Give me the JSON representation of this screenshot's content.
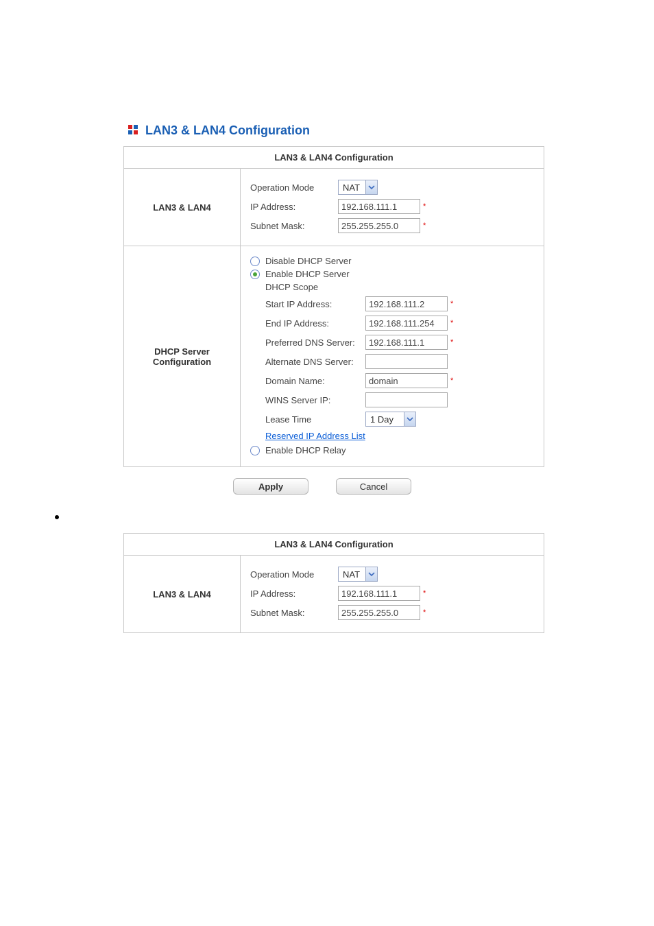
{
  "header": {
    "title": "LAN3 & LAN4 Configuration"
  },
  "section1": {
    "tableTitle": "LAN3 & LAN4 Configuration",
    "lan": {
      "rowLabel": "LAN3 & LAN4",
      "opModeLabel": "Operation Mode",
      "opModeValue": "NAT",
      "ipLabel": "IP Address:",
      "ipValue": "192.168.111.1",
      "maskLabel": "Subnet Mask:",
      "maskValue": "255.255.255.0"
    },
    "dhcp": {
      "rowLabel": "DHCP Server Configuration",
      "disableLabel": "Disable DHCP Server",
      "enableLabel": "Enable DHCP Server",
      "scopeLabel": "DHCP Scope",
      "startIpLabel": "Start IP Address:",
      "startIpValue": "192.168.111.2",
      "endIpLabel": "End IP Address:",
      "endIpValue": "192.168.111.254",
      "prefDnsLabel": "Preferred DNS Server:",
      "prefDnsValue": "192.168.111.1",
      "altDnsLabel": "Alternate DNS Server:",
      "altDnsValue": "",
      "domainLabel": "Domain Name:",
      "domainValue": "domain",
      "winsLabel": "WINS Server IP:",
      "winsValue": "",
      "leaseLabel": "Lease Time",
      "leaseValue": "1 Day",
      "reservedLink": "Reserved IP Address List",
      "relayLabel": "Enable DHCP Relay"
    },
    "buttons": {
      "apply": "Apply",
      "cancel": "Cancel"
    }
  },
  "section2": {
    "tableTitle": "LAN3 & LAN4 Configuration",
    "lan": {
      "rowLabel": "LAN3 & LAN4",
      "opModeLabel": "Operation Mode",
      "opModeValue": "NAT",
      "ipLabel": "IP Address:",
      "ipValue": "192.168.111.1",
      "maskLabel": "Subnet Mask:",
      "maskValue": "255.255.255.0"
    }
  }
}
